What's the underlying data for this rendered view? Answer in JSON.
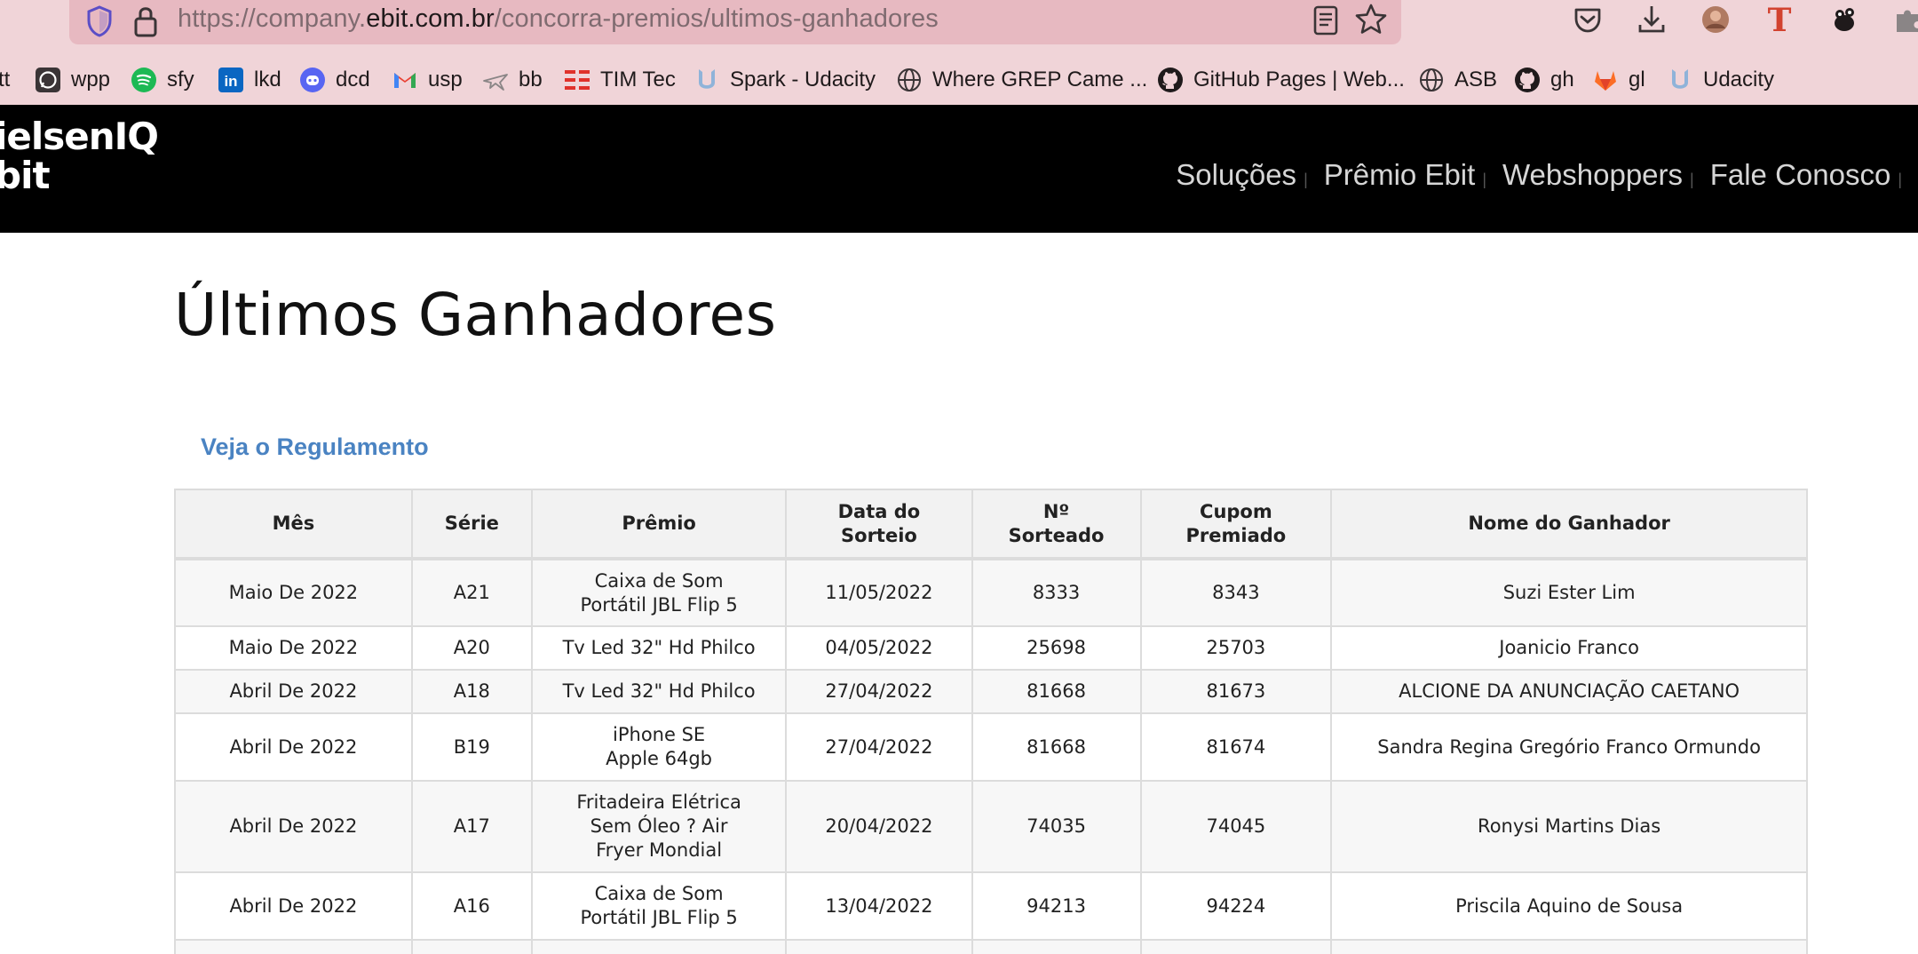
{
  "browser": {
    "url_prefix": "https://company.",
    "url_domain": "ebit.com.br",
    "url_path": "/concorra-premios/ultimos-ganhadores",
    "bookmarks": [
      {
        "label": "tt",
        "icon": "bookmark-partial-icon"
      },
      {
        "label": "wpp",
        "icon": "whatsapp-icon"
      },
      {
        "label": "sfy",
        "icon": "spotify-icon"
      },
      {
        "label": "lkd",
        "icon": "linkedin-icon"
      },
      {
        "label": "dcd",
        "icon": "discord-icon"
      },
      {
        "label": "usp",
        "icon": "gmail-icon"
      },
      {
        "label": "bb",
        "icon": "airplane-icon"
      },
      {
        "label": "TIM Tec",
        "icon": "timtec-icon"
      },
      {
        "label": "Spark - Udacity",
        "icon": "udacity-icon"
      },
      {
        "label": "Where GREP Came ...",
        "icon": "globe-icon"
      },
      {
        "label": "GitHub Pages | Web...",
        "icon": "github-icon"
      },
      {
        "label": "ASB",
        "icon": "globe-icon"
      },
      {
        "label": "gh",
        "icon": "github-icon"
      },
      {
        "label": "gl",
        "icon": "gitlab-icon"
      },
      {
        "label": "Udacity",
        "icon": "udacity-icon"
      }
    ]
  },
  "site": {
    "logo_line1": "ielsenIQ",
    "logo_line2": "bit",
    "nav": [
      "Soluções",
      "Prêmio Ebit",
      "Webshoppers",
      "Fale Conosco"
    ]
  },
  "main": {
    "title": "Últimos Ganhadores",
    "regulamento_link": "Veja o Regulamento",
    "table": {
      "headers": [
        "Mês",
        "Série",
        "Prêmio",
        "Data do Sorteio",
        "Nº Sorteado",
        "Cupom Premiado",
        "Nome do Ganhador"
      ],
      "rows": [
        [
          "Maio De 2022",
          "A21",
          "Caixa de Som Portátil JBL Flip 5",
          "11/05/2022",
          "8333",
          "8343",
          "Suzi Ester Lim"
        ],
        [
          "Maio De 2022",
          "A20",
          "Tv Led 32\" Hd Philco",
          "04/05/2022",
          "25698",
          "25703",
          "Joanicio Franco"
        ],
        [
          "Abril De 2022",
          "A18",
          "Tv Led 32\" Hd Philco",
          "27/04/2022",
          "81668",
          "81673",
          "ALCIONE DA ANUNCIAÇÃO CAETANO"
        ],
        [
          "Abril De 2022",
          "B19",
          "iPhone SE Apple 64gb",
          "27/04/2022",
          "81668",
          "81674",
          "Sandra Regina Gregório Franco Ormundo"
        ],
        [
          "Abril De 2022",
          "A17",
          "Fritadeira Elétrica Sem Óleo ? Air Fryer Mondial",
          "20/04/2022",
          "74035",
          "74045",
          "Ronysi Martins Dias"
        ],
        [
          "Abril De 2022",
          "A16",
          "Caixa de Som Portátil JBL Flip 5",
          "13/04/2022",
          "94213",
          "94224",
          "Priscila Aquino de Sousa"
        ]
      ]
    }
  }
}
